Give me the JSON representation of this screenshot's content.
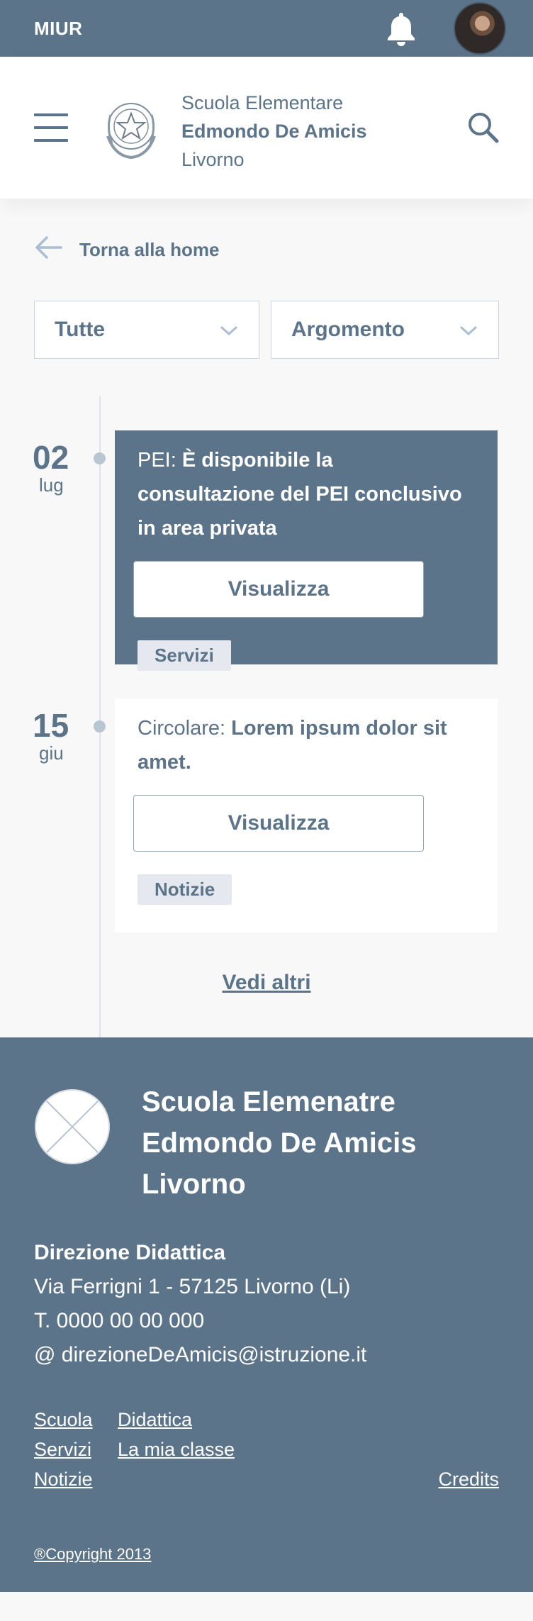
{
  "topbar": {
    "brand": "MIUR",
    "bell_icon": "bell-icon",
    "avatar": "user-avatar"
  },
  "header": {
    "school_line1": "Scuola Elementare",
    "school_line2": "Edmondo De Amicis",
    "school_line3": "Livorno"
  },
  "back": {
    "label": "Torna alla home"
  },
  "filters": {
    "all": "Tutte",
    "topic": "Argomento"
  },
  "timeline": [
    {
      "day": "02",
      "month": "lug",
      "prefix": "PEI:",
      "title": "È disponibile la consultazione del PEI conclusivo in area privata",
      "button": "Visualizza",
      "tag": "Servizi"
    },
    {
      "day": "15",
      "month": "giu",
      "prefix": "Circolare:",
      "title": "Lorem ipsum dolor sit amet.",
      "button": "Visualizza",
      "tag": "Notizie"
    }
  ],
  "more": "Vedi altri",
  "footer": {
    "title_line1": "Scuola Elemenatre",
    "title_line2": "Edmondo De Amicis",
    "title_line3": "Livorno",
    "dept": "Direzione Didattica",
    "address": "Via Ferrigni 1 - 57125 Livorno (Li)",
    "phone": "T. 0000 00 00 000",
    "email": "@ direzioneDeAmicis@istruzione.it",
    "links": {
      "scuola": "Scuola",
      "didattica": "Didattica",
      "servizi": "Servizi",
      "classe": "La mia classe",
      "notizie": "Notizie",
      "credits": "Credits"
    },
    "copyright": "®Copyright 2013"
  },
  "colors": {
    "primary": "#5c7489",
    "background": "#f8f8f8",
    "white": "#ffffff"
  }
}
